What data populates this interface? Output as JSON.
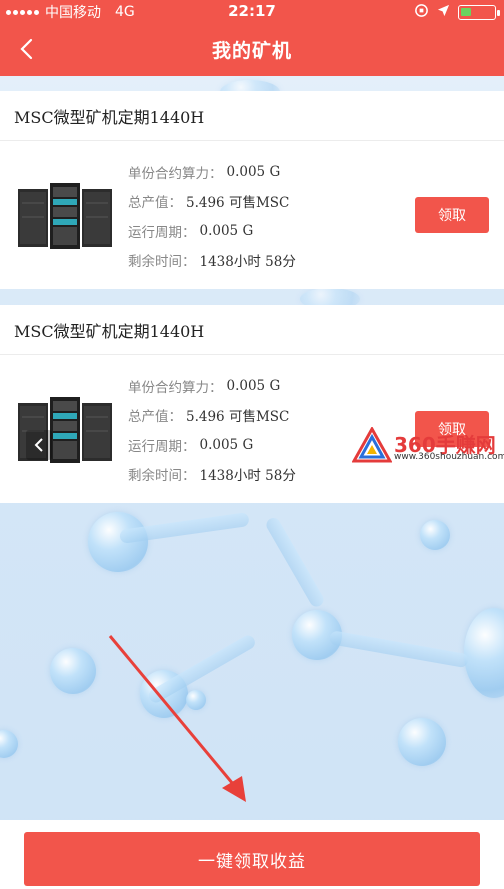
{
  "status_bar": {
    "carrier": "中国移动",
    "network": "4G",
    "time": "22:17"
  },
  "nav": {
    "title": "我的矿机",
    "back_icon": "chevron-left-icon"
  },
  "machines": [
    {
      "name": "MSC微型矿机定期1440H",
      "specs": [
        {
          "label": "单份合约算力：",
          "value": "0.005 G"
        },
        {
          "label": "总产值：",
          "value": "5.496 可售MSC"
        },
        {
          "label": "运行周期：",
          "value": "0.005 G"
        },
        {
          "label": "剩余时间：",
          "value": "1438小时 58分"
        }
      ],
      "button": "领取"
    },
    {
      "name": "MSC微型矿机定期1440H",
      "specs": [
        {
          "label": "单份合约算力：",
          "value": "0.005 G"
        },
        {
          "label": "总产值：",
          "value": "5.496 可售MSC"
        },
        {
          "label": "运行周期：",
          "value": "0.005 G"
        },
        {
          "label": "剩余时间：",
          "value": "1438小时 58分"
        }
      ],
      "button": "领取"
    }
  ],
  "watermark": {
    "text": "360手赚网",
    "url": "www.360shouzhuan.com"
  },
  "bottom": {
    "button": "一键领取收益"
  },
  "colors": {
    "accent": "#f2554b",
    "background": "#d9e9f8",
    "arrow": "#e8403a"
  }
}
